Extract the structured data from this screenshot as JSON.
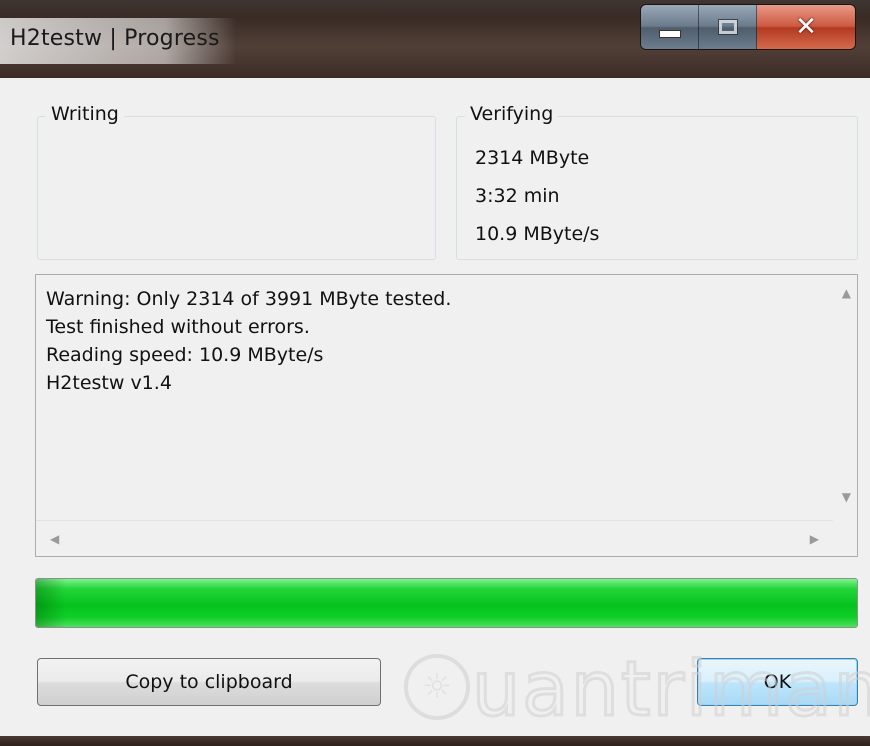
{
  "window": {
    "title": "H2testw | Progress"
  },
  "writing": {
    "label": "Writing"
  },
  "verifying": {
    "label": "Verifying",
    "size": "2314 MByte",
    "time": "3:32 min",
    "speed": "10.9 MByte/s"
  },
  "log": {
    "lines": [
      "Warning: Only 2314 of 3991 MByte tested.",
      "Test finished without errors.",
      "Reading speed: 10.9 MByte/s",
      "H2testw v1.4"
    ]
  },
  "progress": {
    "percent": 100
  },
  "buttons": {
    "copy_label": "Copy to clipboard",
    "ok_label": "OK"
  },
  "watermark": {
    "text": "uantrimang"
  },
  "colors": {
    "progress_green": "#06c21d",
    "close_red": "#cc5a41",
    "ok_blue": "#3c7fb1"
  },
  "icons": {
    "minimize": "minimize-icon",
    "maximize": "maximize-icon",
    "close": "close-icon",
    "scroll_up": "arrow-up-icon",
    "scroll_down": "arrow-down-icon",
    "scroll_left": "arrow-left-icon",
    "scroll_right": "arrow-right-icon"
  }
}
